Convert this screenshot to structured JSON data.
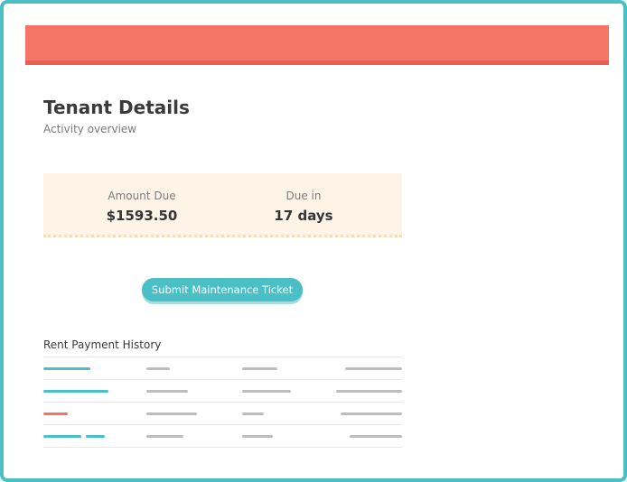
{
  "header": {
    "accent": "#f47565"
  },
  "page": {
    "title": "Tenant Details",
    "subtitle": "Activity overview"
  },
  "summary": {
    "amount_label": "Amount Due",
    "amount_value": "$1593.50",
    "due_label": "Due in",
    "due_value": "17 days"
  },
  "actions": {
    "submit_label": "Submit Maintenance Ticket"
  },
  "history": {
    "title": "Rent Payment History",
    "row_count": 4
  },
  "colors": {
    "teal": "#4bbfc6",
    "coral": "#f47565",
    "summary_bg": "#fdf3e6"
  }
}
